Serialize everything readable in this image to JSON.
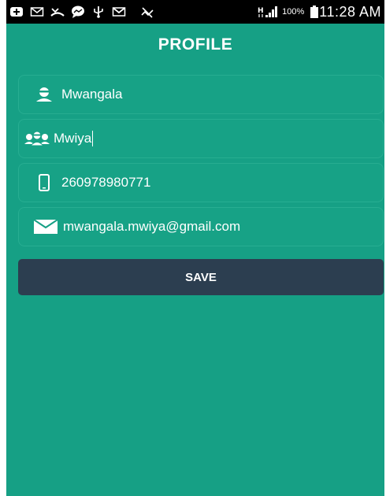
{
  "status_bar": {
    "icons": [
      "add-notification-icon",
      "email-icon",
      "missed-call-icon",
      "messenger-icon",
      "usb-icon",
      "gmail-icon",
      "mute-icon",
      "hspa-icon",
      "signal-icon",
      "battery-icon"
    ],
    "battery": "100%",
    "time": "11:28 AM"
  },
  "header": {
    "title": "PROFILE"
  },
  "form": {
    "first_name": "Mwangala",
    "last_name": "Mwiya",
    "phone": "260978980771",
    "email": "mwangala.mwiya@gmail.com"
  },
  "actions": {
    "save_label": "SAVE"
  },
  "colors": {
    "background": "#16a085",
    "button": "#2c3e50",
    "text": "#ffffff",
    "status_bar": "#000000"
  }
}
